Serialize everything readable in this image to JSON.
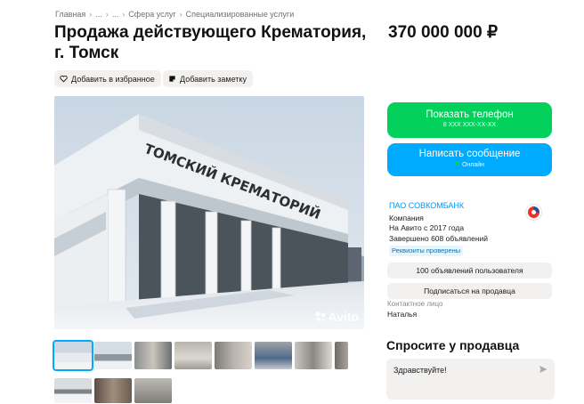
{
  "breadcrumb": {
    "items": [
      "Главная",
      "...",
      "...",
      "Сфера услуг",
      "Специализированные услуги"
    ],
    "separator": "›"
  },
  "listing": {
    "title": "Продажа действующего Крематория, г. Томск",
    "price": "370 000 000 ₽",
    "favorite_label": "Добавить в избранное",
    "note_label": "Добавить заметку",
    "photo_sign": "ТОМСКИЙ КРЕМАТОРИЙ",
    "watermark": "Avito"
  },
  "thumbnails": {
    "count": 11,
    "active_index": 0
  },
  "actions": {
    "phone_label": "Показать телефон",
    "phone_masked": "8 XXX XXX-XX-XX",
    "message_label": "Написать сообщение",
    "online_label": "Онлайн"
  },
  "seller": {
    "name": "ПАО СОВКОМБАНК",
    "type": "Компания",
    "since": "На Авито с 2017 года",
    "completed": "Завершено 608 объявлений",
    "verified": "Реквизиты проверены",
    "ads_button": "100 объявлений пользователя",
    "subscribe_button": "Подписаться на продавца",
    "contact_label": "Контактное лицо",
    "contact_name": "Наталья"
  },
  "ask": {
    "title": "Спросите у продавца",
    "input_value": "Здравствуйте!"
  },
  "colors": {
    "green": "#02d15c",
    "blue": "#00aaff",
    "link": "#0099f7",
    "pill_bg": "#f2f1f0"
  }
}
